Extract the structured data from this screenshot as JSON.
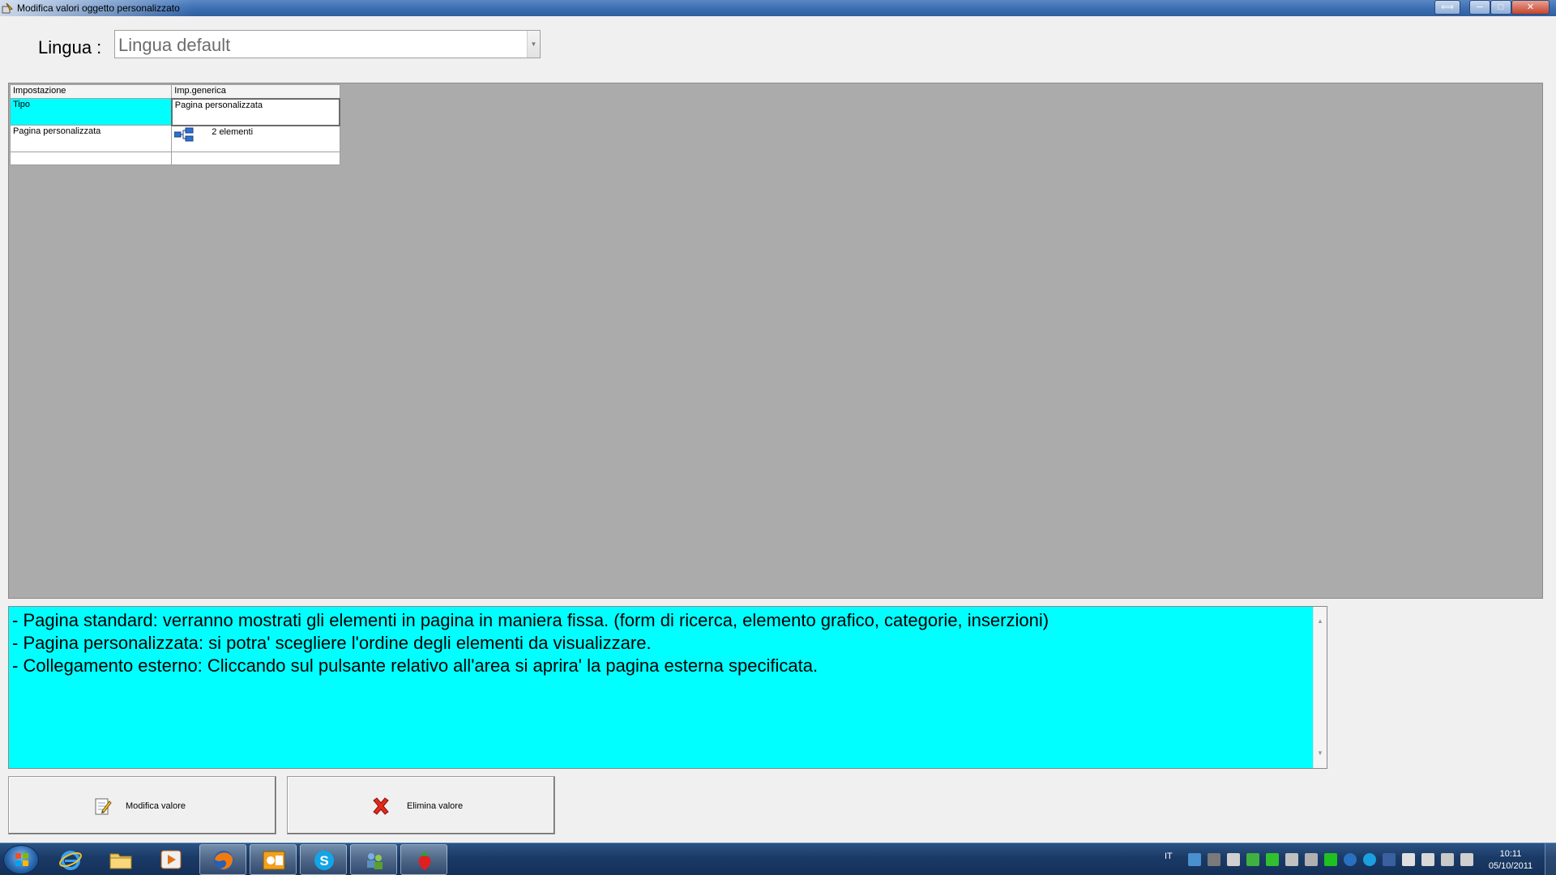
{
  "window": {
    "title": "Modifica valori oggetto personalizzato",
    "buttons": {
      "restore_extra": "⟺",
      "minimize": "─",
      "maximize": "□",
      "close": "✕"
    }
  },
  "language": {
    "label": "Lingua :",
    "selected": "Lingua default"
  },
  "grid": {
    "headers": [
      "Impostazione",
      "Imp.generica"
    ],
    "rows": [
      {
        "setting": "Tipo",
        "value": "Pagina personalizzata"
      },
      {
        "setting": "Pagina personalizzata",
        "value": "2 elementi"
      },
      {
        "setting": "",
        "value": ""
      }
    ]
  },
  "description": {
    "lines": [
      "- Pagina standard: verranno mostrati gli elementi in pagina in maniera fissa. (form di ricerca, elemento grafico, categorie, inserzioni)",
      "- Pagina personalizzata: si potra' scegliere l'ordine degli elementi da visualizzare.",
      "- Collegamento esterno: Cliccando sul pulsante relativo all'area si aprira' la pagina esterna specificata."
    ]
  },
  "actions": {
    "modify_label": "Modifica valore",
    "delete_label": "Elimina valore"
  },
  "taskbar": {
    "tray_language": "IT",
    "time": "10:11",
    "date": "05/10/2011"
  },
  "colors": {
    "selection": "#00ffff",
    "grid_background": "#ababab"
  }
}
